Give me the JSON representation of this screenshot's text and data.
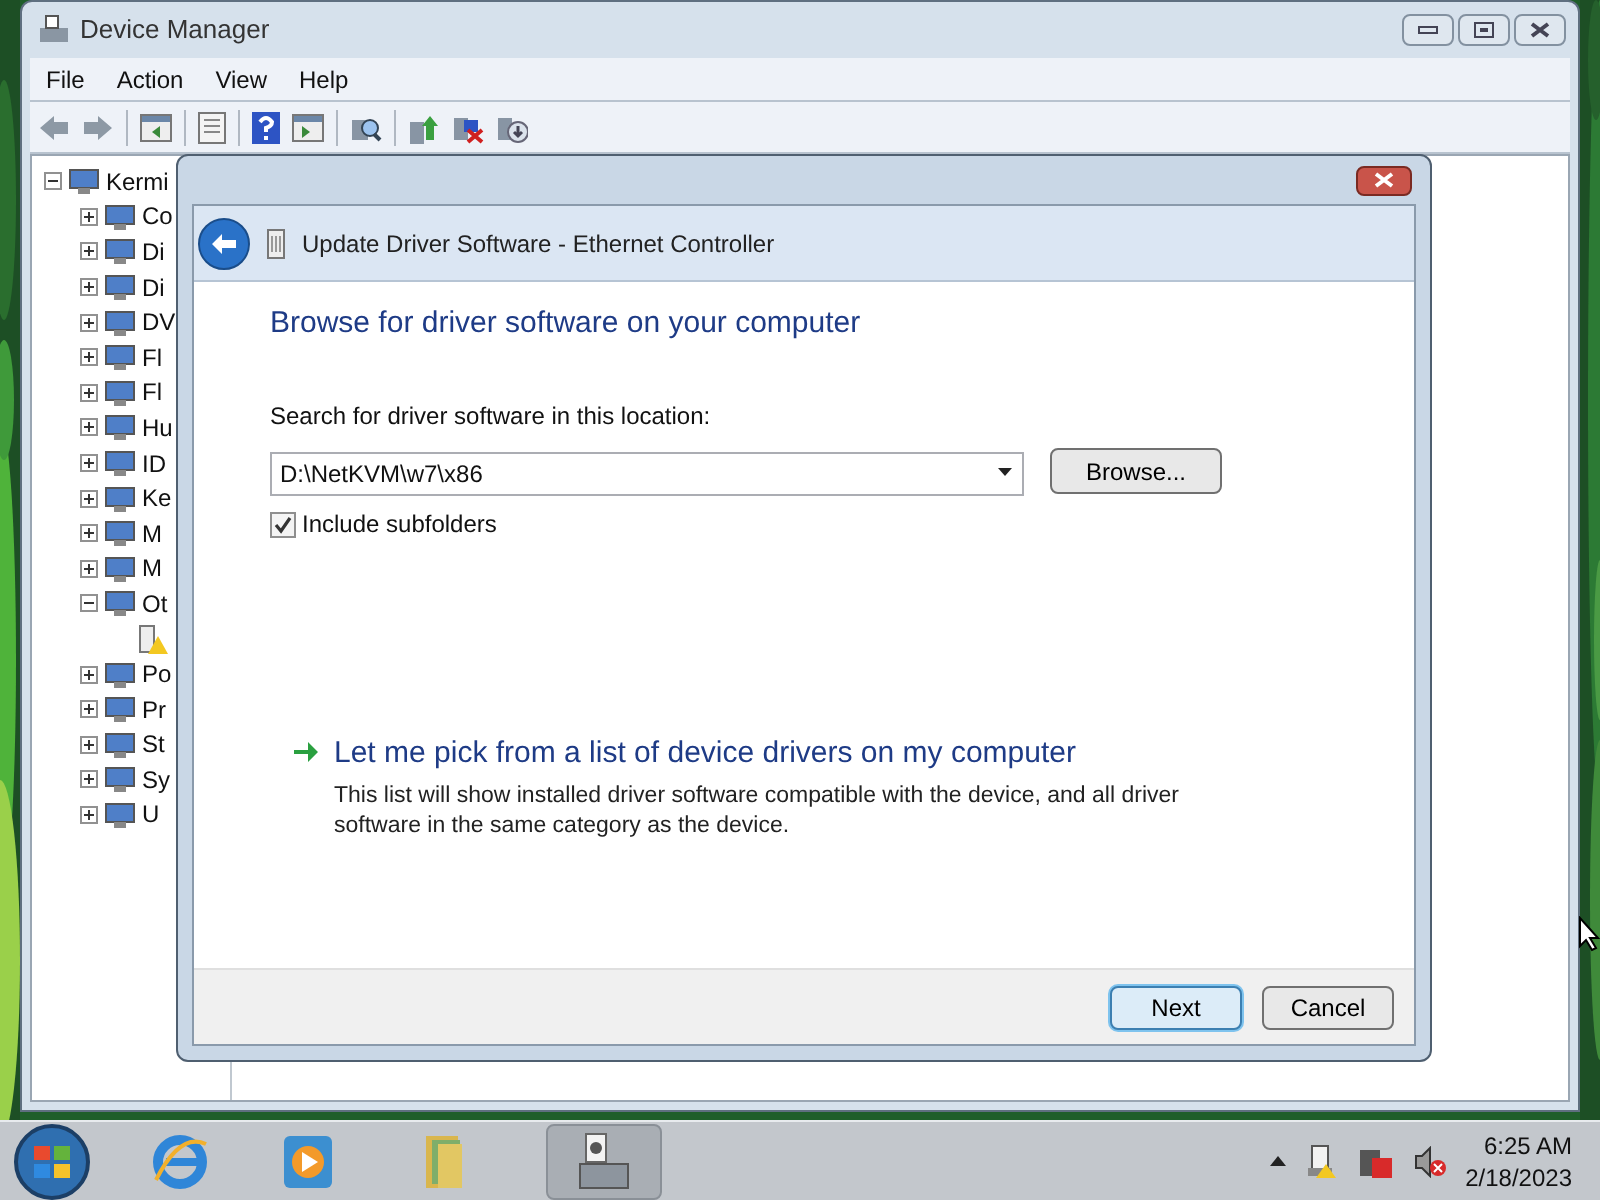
{
  "device_manager": {
    "title": "Device Manager",
    "menu": [
      "File",
      "Action",
      "View",
      "Help"
    ],
    "tree": {
      "label": "Kermi",
      "expanded": true,
      "children": [
        {
          "label": "Co",
          "expanded": false
        },
        {
          "label": "Di",
          "expanded": false
        },
        {
          "label": "Di",
          "expanded": false
        },
        {
          "label": "DV",
          "expanded": false
        },
        {
          "label": "Fl",
          "expanded": false
        },
        {
          "label": "Fl",
          "expanded": false
        },
        {
          "label": "Hu",
          "expanded": false
        },
        {
          "label": "ID",
          "expanded": false
        },
        {
          "label": "Ke",
          "expanded": false
        },
        {
          "label": "M",
          "expanded": false
        },
        {
          "label": "M",
          "expanded": false
        },
        {
          "label": "Ot",
          "expanded": true,
          "children": [
            {
              "warning": true
            }
          ]
        },
        {
          "label": "Po",
          "expanded": false
        },
        {
          "label": "Pr",
          "expanded": false
        },
        {
          "label": "St",
          "expanded": false
        },
        {
          "label": "Sy",
          "expanded": false
        },
        {
          "label": "U",
          "expanded": false
        }
      ]
    }
  },
  "dialog": {
    "title": "Update Driver Software - Ethernet Controller",
    "heading": "Browse for driver software on your computer",
    "location_label": "Search for driver software in this location:",
    "location_value": "D:\\NetKVM\\w7\\x86",
    "browse_button": "Browse...",
    "include_subfolders": {
      "label": "Include subfolders",
      "checked": true
    },
    "link": {
      "title": "Let me pick from a list of device drivers on my computer",
      "description": "This list will show installed driver software compatible with the device, and all driver software in the same category as the device."
    },
    "buttons": [
      {
        "label": "Next",
        "default": true
      },
      {
        "label": "Cancel",
        "default": false
      }
    ]
  },
  "taskbar": {
    "time": "6:25 AM",
    "date": "2/18/2023"
  }
}
